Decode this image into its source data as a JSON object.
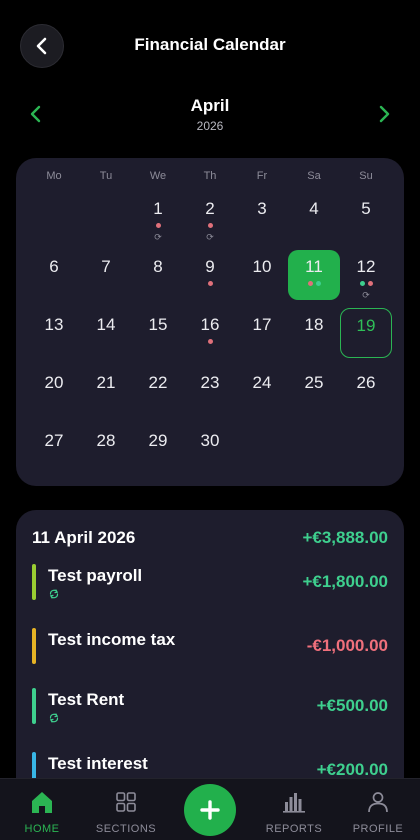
{
  "header": {
    "title": "Financial Calendar",
    "back_icon": "chevron-left-icon"
  },
  "month_nav": {
    "month": "April",
    "year": "2026",
    "prev_icon": "chevron-left-icon",
    "next_icon": "chevron-right-icon",
    "accent": "#2bb553"
  },
  "calendar": {
    "weekdays": [
      "Mo",
      "Tu",
      "We",
      "Th",
      "Fr",
      "Sa",
      "Su"
    ],
    "days": [
      "1",
      "2",
      "3",
      "4",
      "5",
      "6",
      "7",
      "8",
      "9",
      "10",
      "11",
      "12",
      "13",
      "14",
      "15",
      "16",
      "17",
      "18",
      "19",
      "20",
      "21",
      "22",
      "23",
      "24",
      "25",
      "26",
      "27",
      "28",
      "29",
      "30"
    ],
    "selected_day": "11",
    "today": "19",
    "markers": {
      "1": {
        "dots": [
          "#e0707a"
        ],
        "recurring": true
      },
      "2": {
        "dots": [
          "#e0707a"
        ],
        "recurring": true
      },
      "9": {
        "dots": [
          "#e0707a"
        ],
        "recurring": false
      },
      "11": {
        "dots": [
          "#e0707a",
          "#3ecf8e"
        ],
        "recurring": false
      },
      "12": {
        "dots": [
          "#3ecf8e",
          "#e0707a"
        ],
        "recurring": true
      },
      "16": {
        "dots": [
          "#e0707a"
        ],
        "recurring": false
      }
    }
  },
  "details": {
    "date": "11 April 2026",
    "total": "+€3,888.00",
    "transactions": [
      {
        "name": "Test payroll",
        "amount": "+€1,800.00",
        "bar_color": "#9acd32",
        "amount_color": "#3ecf8e",
        "recurring": true
      },
      {
        "name": "Test income tax",
        "amount": "-€1,000.00",
        "bar_color": "#e6b325",
        "amount_color": "#f0707c",
        "recurring": false
      },
      {
        "name": "Test Rent",
        "amount": "+€500.00",
        "bar_color": "#3ecf8e",
        "amount_color": "#3ecf8e",
        "recurring": true
      },
      {
        "name": "Test interest",
        "amount": "+€200.00",
        "bar_color": "#38b6e6",
        "amount_color": "#3ecf8e",
        "recurring": false
      }
    ]
  },
  "bottom_nav": {
    "items": [
      {
        "label": "HOME",
        "icon": "home-icon"
      },
      {
        "label": "SECTIONS",
        "icon": "grid-icon"
      },
      {
        "label": "REPORTS",
        "icon": "bar-chart-icon"
      },
      {
        "label": "PROFILE",
        "icon": "user-icon"
      }
    ],
    "add_icon": "plus-icon"
  }
}
